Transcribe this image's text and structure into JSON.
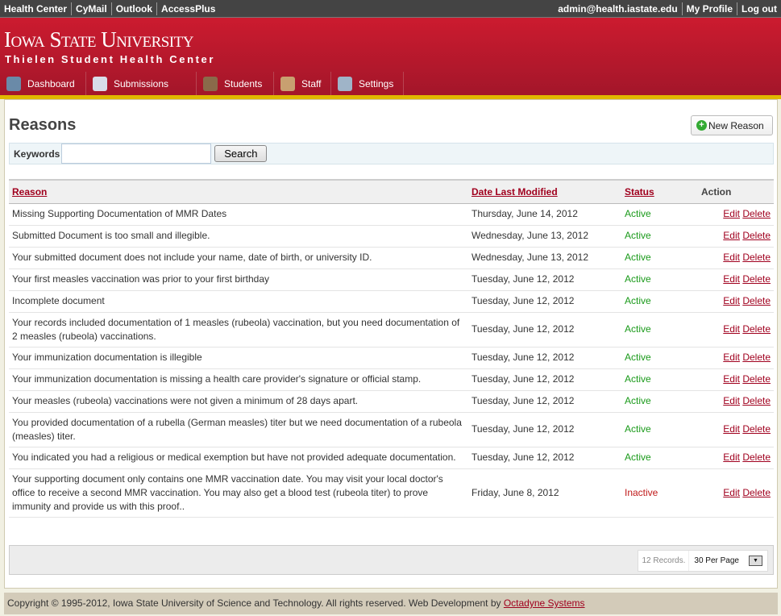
{
  "topbar": {
    "links": [
      "Health Center",
      "CyMail",
      "Outlook",
      "AccessPlus"
    ],
    "user": "admin@health.iastate.edu",
    "profile": "My Profile",
    "logout": "Log out"
  },
  "header": {
    "logo": "Iowa State University",
    "subtitle": "Thielen Student Health Center"
  },
  "nav": [
    {
      "label": "Dashboard",
      "icon": "home-icon",
      "color": "#6a8aa8"
    },
    {
      "label": "Submissions",
      "icon": "document-icon",
      "color": "#d8dce8"
    },
    {
      "label": "Students",
      "icon": "graduate-icon",
      "color": "#8a6a4a"
    },
    {
      "label": "Staff",
      "icon": "staff-icon",
      "color": "#c8a070"
    },
    {
      "label": "Settings",
      "icon": "tools-icon",
      "color": "#9fb4c8"
    }
  ],
  "page": {
    "title": "Reasons",
    "new_button": "New Reason",
    "keywords_label": "Keywords",
    "keywords_value": "",
    "search_button": "Search"
  },
  "table": {
    "headers": {
      "reason": "Reason",
      "date": "Date Last Modified",
      "status": "Status",
      "action": "Action"
    },
    "edit": "Edit",
    "delete": "Delete",
    "rows": [
      {
        "reason": "Missing Supporting Documentation of MMR Dates",
        "date": "Thursday, June 14, 2012",
        "status": "Active"
      },
      {
        "reason": "Submitted Document is too small and illegible.",
        "date": "Wednesday, June 13, 2012",
        "status": "Active"
      },
      {
        "reason": "Your submitted document does not include your name, date of birth, or university ID.",
        "date": "Wednesday, June 13, 2012",
        "status": "Active"
      },
      {
        "reason": "Your first measles vaccination was prior to your first birthday",
        "date": "Tuesday, June 12, 2012",
        "status": "Active"
      },
      {
        "reason": "Incomplete document",
        "date": "Tuesday, June 12, 2012",
        "status": "Active"
      },
      {
        "reason": "Your records included documentation of 1 measles (rubeola) vaccination, but you need documentation of 2 measles (rubeola) vaccinations.",
        "date": "Tuesday, June 12, 2012",
        "status": "Active"
      },
      {
        "reason": "Your immunization documentation is illegible",
        "date": "Tuesday, June 12, 2012",
        "status": "Active"
      },
      {
        "reason": "Your immunization documentation is missing a health care provider's signature or official stamp.",
        "date": "Tuesday, June 12, 2012",
        "status": "Active"
      },
      {
        "reason": "Your measles (rubeola) vaccinations were not given a minimum of 28 days apart.",
        "date": "Tuesday, June 12, 2012",
        "status": "Active"
      },
      {
        "reason": "You provided documentation of a rubella (German measles) titer but we need documentation of a rubeola (measles) titer.",
        "date": "Tuesday, June 12, 2012",
        "status": "Active"
      },
      {
        "reason": "You indicated you had a religious or medical exemption but have not provided adequate documentation.",
        "date": "Tuesday, June 12, 2012",
        "status": "Active"
      },
      {
        "reason": "Your supporting document only contains one MMR vaccination date. You may visit your local doctor's office to receive a second MMR vaccination. You may also get a blood test (rubeola titer) to prove immunity and provide us with this proof..",
        "date": "Friday, June 8, 2012",
        "status": "Inactive"
      }
    ]
  },
  "pager": {
    "records": "12 Records.",
    "per_page": "30 Per Page"
  },
  "footer": {
    "text": "Copyright © 1995-2012, Iowa State University of Science and Technology. All rights reserved. Web Development by ",
    "link": "Octadyne Systems"
  }
}
